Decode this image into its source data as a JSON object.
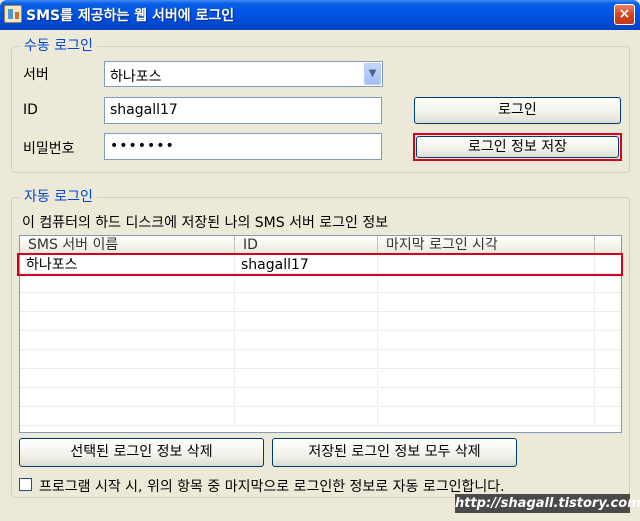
{
  "window": {
    "title": "SMS를 제공하는 웹 서버에 로그인",
    "close_glyph": "×"
  },
  "manual_login": {
    "legend": "수동 로그인",
    "server_label": "서버",
    "server_selected": "하나포스",
    "id_label": "ID",
    "id_value": "shagall17",
    "password_label": "비밀번호",
    "password_value": "•••••••",
    "login_button": "로그인",
    "save_button": "로그인 정보 저장"
  },
  "auto_login": {
    "legend": "자동 로그인",
    "description": "이 컴퓨터의 하드 디스크에 저장된 나의 SMS 서버 로그인 정보",
    "columns": [
      "SMS 서버 이름",
      "ID",
      "마지막 로그인 시각"
    ],
    "rows": [
      [
        "하나포스",
        "shagall17",
        ""
      ]
    ],
    "delete_selected_button": "선택된 로그인 정보 삭제",
    "delete_all_button": "저장된 로그인 정보 모두 삭제",
    "auto_login_checkbox_label": "프로그램 시작 시, 위의 항목 중 마지막으로 로그인한 정보로 자동 로그인합니다.",
    "auto_login_checked": false
  },
  "watermark": "http://shagall.tistory.com",
  "icons": {
    "app": "app-icon",
    "close": "close-icon",
    "dropdown": "chevron-down-icon"
  }
}
